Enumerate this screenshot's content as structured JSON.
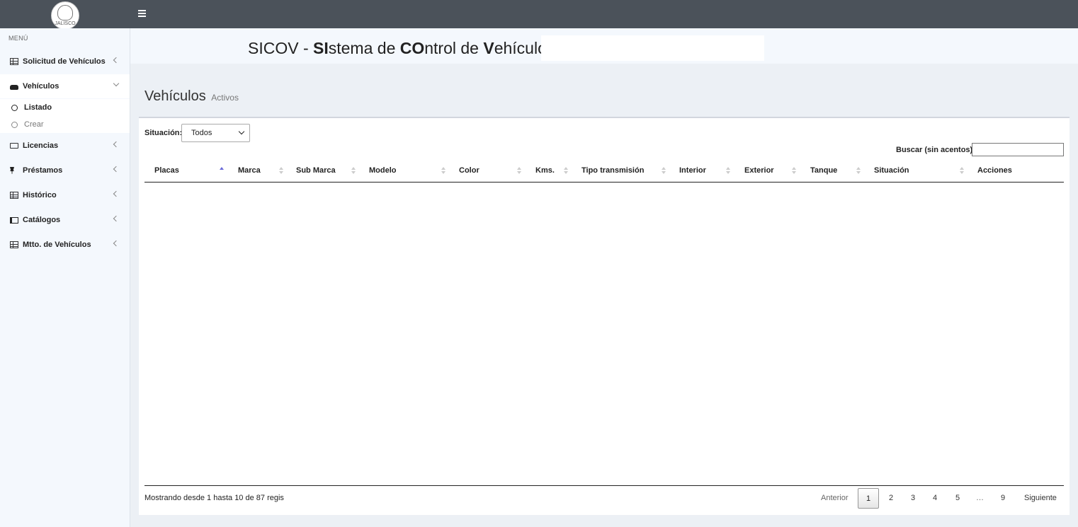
{
  "logo": {
    "text": "JALISCO"
  },
  "sidebar": {
    "header": "MENÚ",
    "items": [
      {
        "label": "Solicitud de Vehículos",
        "icon": "table-icon"
      },
      {
        "label": "Vehículos",
        "icon": "car-icon",
        "expanded": true,
        "children": [
          {
            "label": "Listado",
            "active": true
          },
          {
            "label": "Crear",
            "active": false
          }
        ]
      },
      {
        "label": "Licencias",
        "icon": "keyboard-icon"
      },
      {
        "label": "Préstamos",
        "icon": "pushpin-icon"
      },
      {
        "label": "Histórico",
        "icon": "newspaper-icon"
      },
      {
        "label": "Catálogos",
        "icon": "map-icon"
      },
      {
        "label": "Mtto. de Vehículos",
        "icon": "table-icon"
      }
    ]
  },
  "header": {
    "title_prefix": "SICOV - ",
    "title_parts": [
      {
        "bold": "SI",
        "rest": "stema de "
      },
      {
        "bold": "CO",
        "rest": "ntrol de "
      },
      {
        "bold": "V",
        "rest": "ehículos"
      }
    ]
  },
  "page": {
    "title": "Vehículos",
    "subtitle": "Activos"
  },
  "filter": {
    "label": "Situación:",
    "selected": "Todos"
  },
  "search": {
    "label": "Buscar (sin acentos):",
    "value": ""
  },
  "table": {
    "columns": [
      "Placas",
      "Marca",
      "Sub Marca",
      "Modelo",
      "Color",
      "Kms.",
      "Tipo transmisión",
      "Interior",
      "Exterior",
      "Tanque",
      "Situación",
      "Acciones"
    ],
    "sorted_column": "Placas",
    "sort_direction": "asc",
    "rows": []
  },
  "footer": {
    "info": "Mostrando desde 1 hasta 10 de 87 regis",
    "prev": "Anterior",
    "pages": [
      "1",
      "2",
      "3",
      "4",
      "5",
      "…",
      "9"
    ],
    "current_page": "1",
    "next": "Siguiente"
  },
  "colors": {
    "topbar": "#4b525a",
    "sidebar": "#f4f8fd",
    "content_bg": "#ecf0f5",
    "sort_active": "#6a6ad8"
  }
}
